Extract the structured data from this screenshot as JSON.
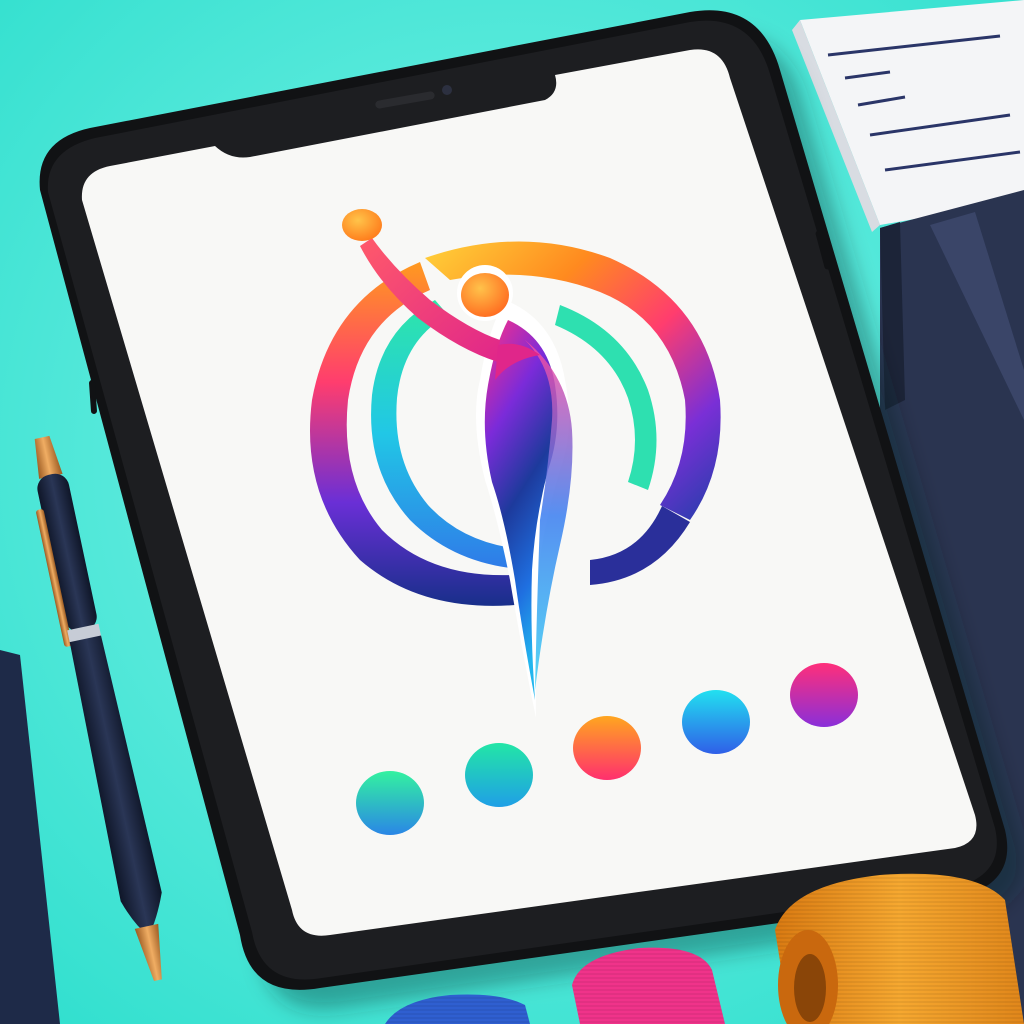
{
  "scene": {
    "background_color": "#3fe6d6",
    "background_highlight": "#7ff3e8",
    "objects": [
      "tablet",
      "logo-artwork",
      "color-swatches",
      "pen",
      "notepad",
      "dark-folder",
      "fabric-rolls"
    ]
  },
  "tablet": {
    "bezel_color": "#161719",
    "screen_color": "#f8f8f6",
    "camera_icon": "camera-dot",
    "speaker_icon": "speaker-slot"
  },
  "logo": {
    "description_icon": "dancer-figure-icon",
    "ring_colors": [
      "#ffd23a",
      "#ff8a1f",
      "#ff3d6e",
      "#7a2fd6",
      "#1f3fa8"
    ],
    "inner_ring_colors": [
      "#2ee6a8",
      "#21c7e6",
      "#2f7be8"
    ],
    "figure_colors": [
      "#ff2f86",
      "#7b2bd9",
      "#1d3a9c",
      "#1f6fe0",
      "#22b6ee"
    ],
    "head_color": "#ff9a2a",
    "hand_ball_color": "#ff8a1f"
  },
  "swatches": [
    {
      "name": "green-cyan",
      "from": "#33f2a0",
      "to": "#2a86e6"
    },
    {
      "name": "teal-green",
      "from": "#23e6a6",
      "to": "#1f9fe6"
    },
    {
      "name": "orange-magenta",
      "from": "#ffa61f",
      "to": "#ff2f6e"
    },
    {
      "name": "cyan-blue",
      "from": "#22e0f0",
      "to": "#2f5fe8"
    },
    {
      "name": "pink-purple",
      "from": "#ff2f7a",
      "to": "#8a2fd9"
    }
  ],
  "pen": {
    "body_color": "#1c2740",
    "trim_color": "#d98a3a"
  },
  "fabric_rolls": [
    {
      "name": "blue-roll",
      "color": "#2f5fd0"
    },
    {
      "name": "pink-roll",
      "color": "#f0338a"
    },
    {
      "name": "orange-roll",
      "color": "#f09a22"
    }
  ]
}
